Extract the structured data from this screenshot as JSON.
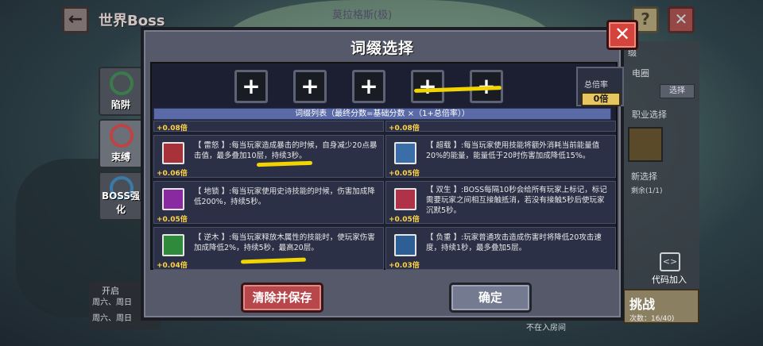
{
  "background": {
    "title": "世界Boss",
    "boss_name": "莫拉格斯(极)",
    "back_icon": "←",
    "help_icon": "?",
    "close_icon": "✕",
    "tabs": [
      {
        "label": "陷阱"
      },
      {
        "label": "束缚"
      },
      {
        "label": "BOSS强化"
      }
    ],
    "right_panel": {
      "line1": "缀",
      "line2": "电圈",
      "select_label": "选择",
      "line3": "职业选择",
      "line4": "新选择",
      "line5": "剩余(1/1)",
      "code_join_icon": "<>",
      "code_join_label": "代码加入",
      "challenge_label": "挑战",
      "challenge_count": "次数：16/40)",
      "not_in_room": "不在入房间"
    },
    "bottom_left": {
      "line1": "开启",
      "line2": "周六、周日",
      "line3": "周六、周日"
    }
  },
  "modal": {
    "title": "词缀选择",
    "close_icon": "✕",
    "slots": [
      "+",
      "+",
      "+",
      "+",
      "+"
    ],
    "multiplier_label": "总倍率",
    "multiplier_value": "0倍",
    "list_header": "词缀列表（最终分数=基础分数 ×（1+总倍率））",
    "affixes": [
      {
        "text": "",
        "mult": "+0.08倍"
      },
      {
        "text": "",
        "mult": "+0.08倍"
      },
      {
        "text": "【 雷怒 】:每当玩家造成暴击的时候，自身减少20点暴击值，最多叠加10层，持续3秒。",
        "mult": "+0.06倍",
        "icon": "thunder-rage-icon"
      },
      {
        "text": "【 超载 】:每当玩家使用技能将额外消耗当前能量值20%的能量，能量低于20时伤害加成降低15%。",
        "mult": "+0.05倍",
        "icon": "overload-icon"
      },
      {
        "text": "【 地锁 】:每当玩家使用史诗技能的时候，伤害加成降低200%，持续5秒。",
        "mult": "+0.05倍",
        "icon": "earth-lock-icon"
      },
      {
        "text": "【 双生 】:BOSS每隔10秒会给所有玩家上标记，标记需要玩家之间相互接触抵消，若没有接触5秒后使玩家沉默5秒。",
        "mult": "+0.05倍",
        "icon": "twin-icon"
      },
      {
        "text": "【 逆木 】:每当玩家释放木属性的技能时，使玩家伤害加成降低2%，持续5秒，最高20层。",
        "mult": "+0.04倍",
        "icon": "reverse-wood-icon"
      },
      {
        "text": "【 负重 】:玩家普通攻击造成伤害时将降低20攻击速度，持续1秒，最多叠加5层。",
        "mult": "+0.03倍",
        "icon": "burden-icon"
      }
    ],
    "clear_button": "清除并保存",
    "confirm_button": "确定"
  }
}
